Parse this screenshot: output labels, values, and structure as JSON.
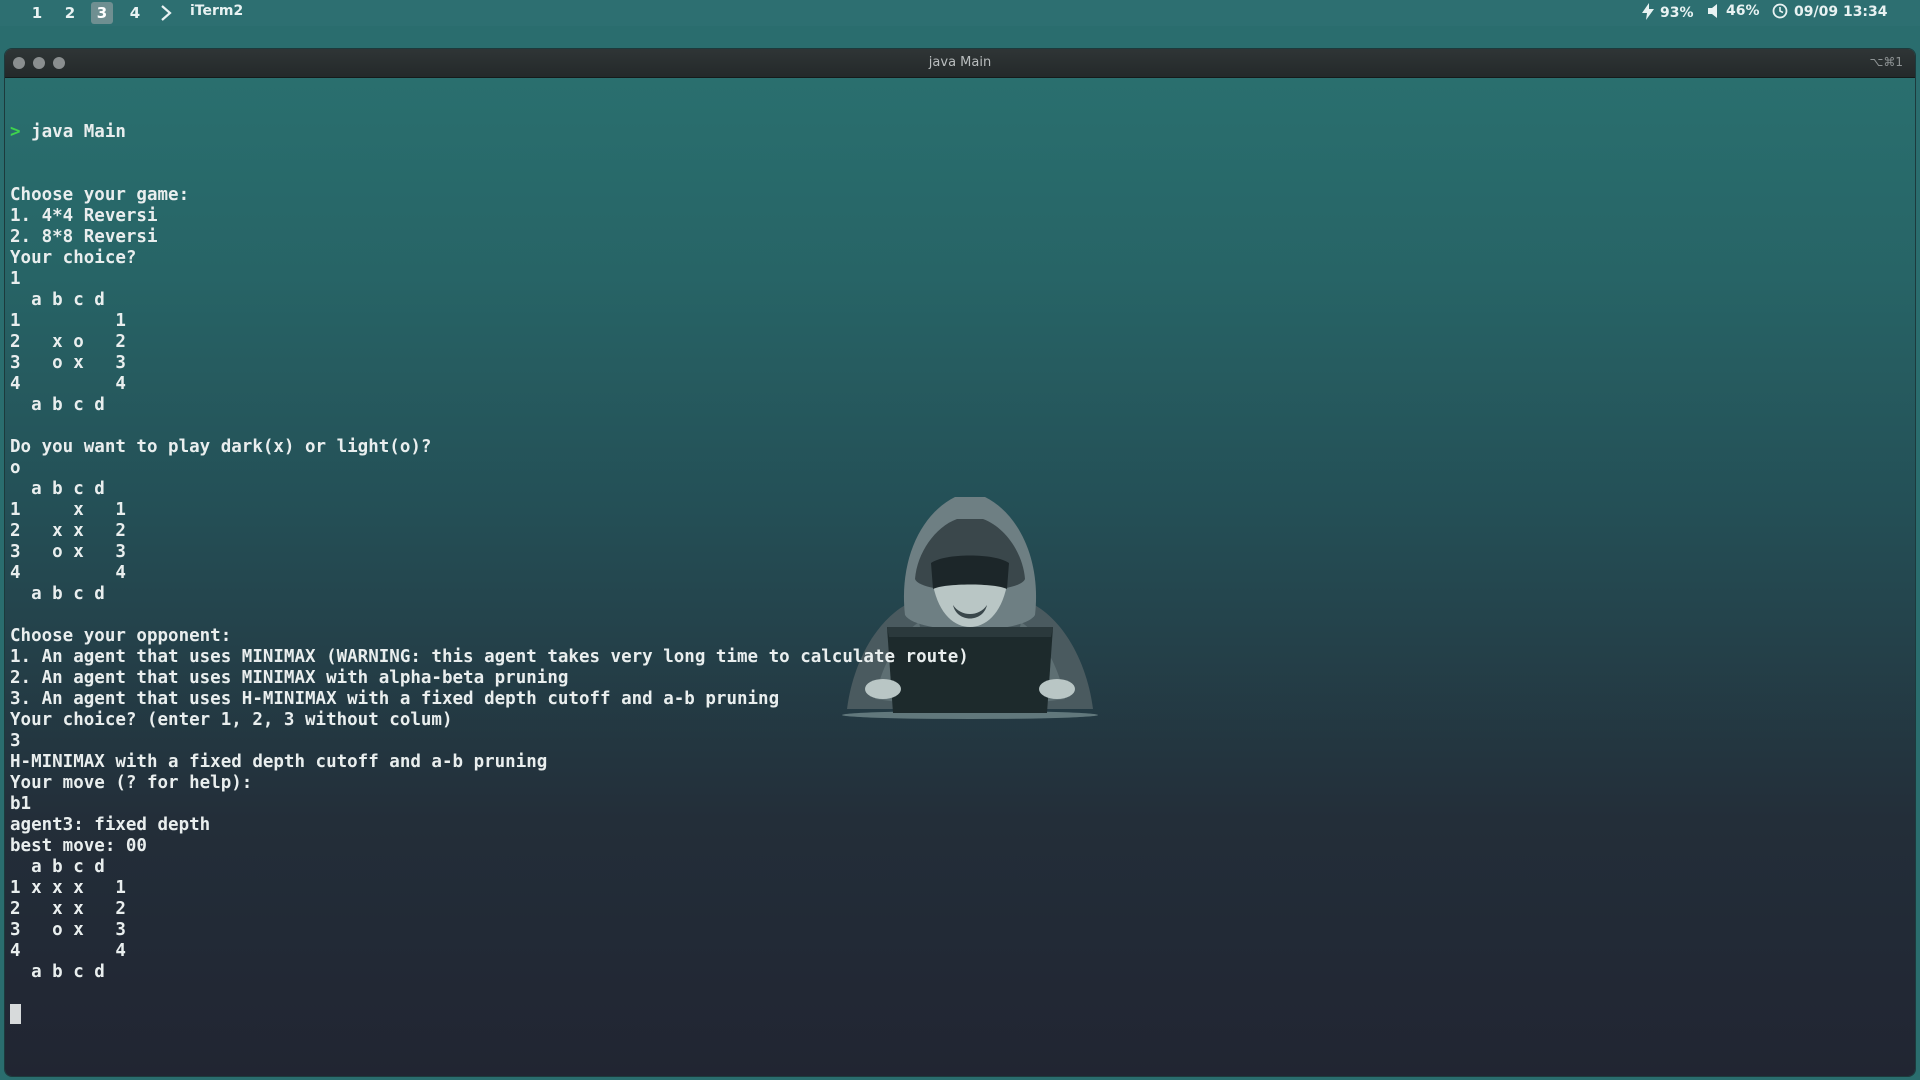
{
  "menubar": {
    "workspaces": [
      "1",
      "2",
      "3",
      "4"
    ],
    "active_workspace": "3",
    "chevron_icon": "chevron-right-icon",
    "app_name": "iTerm2",
    "battery": "93%",
    "volume": "46%",
    "datetime": "09/09 13:34",
    "icons": {
      "battery": "lightning-bolt-icon",
      "volume": "speaker-icon",
      "clock": "clock-icon"
    }
  },
  "window": {
    "title": "java Main",
    "shortcut": "⌥⌘1"
  },
  "terminal": {
    "prompt_symbol": ">",
    "command": " java Main",
    "lines": [
      "Choose your game:",
      "1. 4*4 Reversi",
      "2. 8*8 Reversi",
      "Your choice?",
      "1",
      "  a b c d",
      "1         1",
      "2   x o   2",
      "3   o x   3",
      "4         4",
      "  a b c d",
      "",
      "Do you want to play dark(x) or light(o)?",
      "o",
      "  a b c d",
      "1     x   1",
      "2   x x   2",
      "3   o x   3",
      "4         4",
      "  a b c d",
      "",
      "Choose your opponent:",
      "1. An agent that uses MINIMAX (WARNING: this agent takes very long time to calculate route)",
      "2. An agent that uses MINIMAX with alpha-beta pruning",
      "3. An agent that uses H-MINIMAX with a fixed depth cutoff and a-b pruning",
      "Your choice? (enter 1, 2, 3 without colum)",
      "3",
      "H-MINIMAX with a fixed depth cutoff and a-b pruning",
      "Your move (? for help):",
      "b1",
      "agent3: fixed depth",
      "best move: 00",
      "  a b c d",
      "1 x x x   1",
      "2   x x   2",
      "3   o x   3",
      "4         4",
      "  a b c d",
      ""
    ]
  },
  "colors": {
    "menubar_bg": "#2d6f71",
    "prompt_green": "#3fd34d",
    "terminal_text": "#e9eeee"
  },
  "wallpaper": {
    "illustration": "hooded-hacker-with-laptop"
  }
}
